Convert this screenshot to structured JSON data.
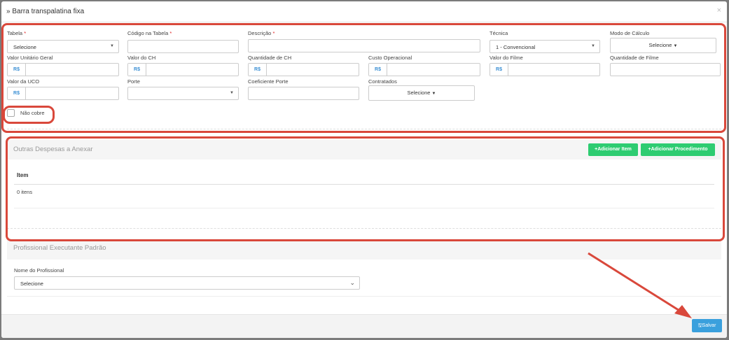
{
  "modal": {
    "title": "» Barra transpalatina fixa",
    "close": "×"
  },
  "form": {
    "tabela": {
      "label": "Tabela",
      "req": "*",
      "value": "Selecione"
    },
    "codigo": {
      "label": "Código na Tabela",
      "req": "*"
    },
    "descricao": {
      "label": "Descrição",
      "req": "*"
    },
    "tecnica": {
      "label": "Técnica",
      "value": "1 - Convencional"
    },
    "modo_calculo": {
      "label": "Modo de Cálculo",
      "value": "Selecione"
    },
    "valor_unitario": {
      "label": "Valor Unitário Geral",
      "addon": "R$"
    },
    "valor_ch": {
      "label": "Valor do CH",
      "addon": "R$"
    },
    "quantidade_ch": {
      "label": "Quantidade de CH",
      "addon": "R$"
    },
    "custo_operacional": {
      "label": "Custo Operacional",
      "addon": "R$"
    },
    "valor_filme": {
      "label": "Valor do Filme",
      "addon": "R$"
    },
    "quantidade_filme": {
      "label": "Quantidade de Filme"
    },
    "valor_uco": {
      "label": "Valor da UCO",
      "addon": "R$"
    },
    "porte": {
      "label": "Porte"
    },
    "coeficiente_porte": {
      "label": "Coeficiente Porte"
    },
    "contratados": {
      "label": "Contratados",
      "value": "Selecione"
    },
    "nao_cobre": {
      "label": "Não cobre"
    }
  },
  "outras_despesas": {
    "title": "Outras Despesas a Anexar",
    "add_item": "Adicionar Item",
    "add_procedimento": "Adicionar Procedimento",
    "column_item": "Item",
    "count": "0 itens"
  },
  "profissional": {
    "title": "Profissional Executante Padrão",
    "label": "Nome do Profissional",
    "value": "Selecione"
  },
  "footer": {
    "save": "Salvar"
  },
  "colors": {
    "highlight": "#d9483b",
    "green": "#2ecc71",
    "blue": "#3aa0dd",
    "addon": "#3b8fd4"
  }
}
